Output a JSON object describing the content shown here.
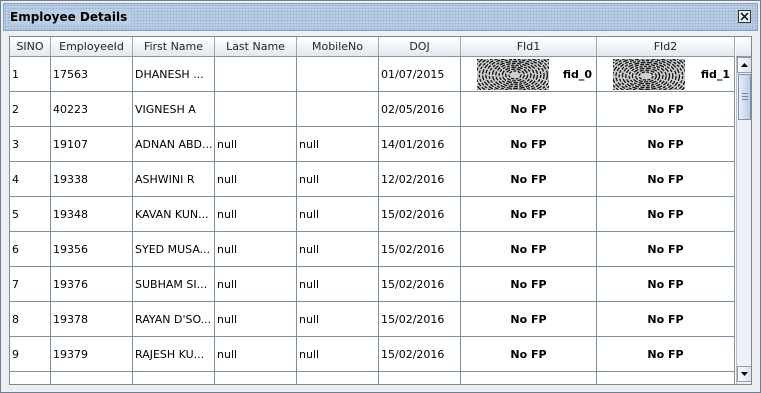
{
  "window": {
    "title": "Employee Details"
  },
  "table": {
    "columns": [
      "SINO",
      "EmployeeId",
      "First Name",
      "Last Name",
      "MobileNo",
      "DOJ",
      "FId1",
      "FId2"
    ],
    "rows": [
      [
        "1",
        "17563",
        "DHANESH ...",
        "",
        "",
        "01/07/2015",
        "fid_0",
        "fid_1"
      ],
      [
        "2",
        "40223",
        "VIGNESH A",
        "",
        "",
        "02/05/2016",
        "No FP",
        "No FP"
      ],
      [
        "3",
        "19107",
        "ADNAN ABD...",
        "null",
        "null",
        "14/01/2016",
        "No FP",
        "No FP"
      ],
      [
        "4",
        "19338",
        "ASHWINI R",
        "null",
        "null",
        "12/02/2016",
        "No FP",
        "No FP"
      ],
      [
        "5",
        "19348",
        "KAVAN KUN...",
        "null",
        "null",
        "15/02/2016",
        "No FP",
        "No FP"
      ],
      [
        "6",
        "19356",
        "SYED MUSA...",
        "null",
        "null",
        "15/02/2016",
        "No FP",
        "No FP"
      ],
      [
        "7",
        "19376",
        "SUBHAM SI...",
        "null",
        "null",
        "15/02/2016",
        "No FP",
        "No FP"
      ],
      [
        "8",
        "19378",
        "RAYAN D'SO...",
        "null",
        "null",
        "15/02/2016",
        "No FP",
        "No FP"
      ],
      [
        "9",
        "19379",
        "RAJESH KU...",
        "null",
        "null",
        "15/02/2016",
        "No FP",
        "No FP"
      ]
    ]
  },
  "icons": {
    "close": "close-icon",
    "scroll_up": "arrow-up-icon",
    "scroll_down": "arrow-down-icon",
    "fingerprint": "fingerprint-icon"
  },
  "colors": {
    "title_bar": "#b8cfe5",
    "grid_lines": "#7b8fa6",
    "header_bg": "#e3e8ee"
  }
}
